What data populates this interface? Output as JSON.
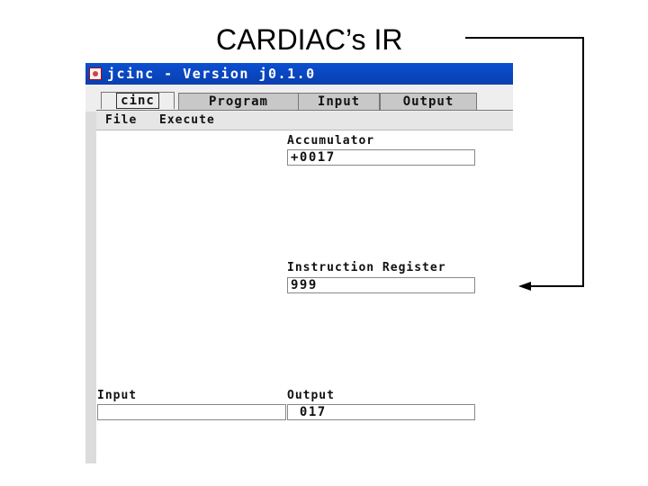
{
  "slide": {
    "title": "CARDIAC’s IR"
  },
  "window": {
    "title": "jcinc - Version j0.1.0",
    "icon": "app-icon"
  },
  "tabs": [
    {
      "label": "cinc",
      "active": true
    },
    {
      "label": "Program",
      "active": false
    },
    {
      "label": "Input",
      "active": false
    },
    {
      "label": "Output",
      "active": false
    }
  ],
  "menu": {
    "file": "File",
    "execute": "Execute"
  },
  "accumulator": {
    "label": "Accumulator",
    "value": "+0017"
  },
  "instruction_register": {
    "label": "Instruction Register",
    "value": "999"
  },
  "input": {
    "label": "Input",
    "value": ""
  },
  "output": {
    "label": "Output",
    "value": " 017"
  },
  "colors": {
    "titlebar": "#0a4fd1",
    "window_bg": "#eeeeee",
    "arrow": "#000000"
  }
}
